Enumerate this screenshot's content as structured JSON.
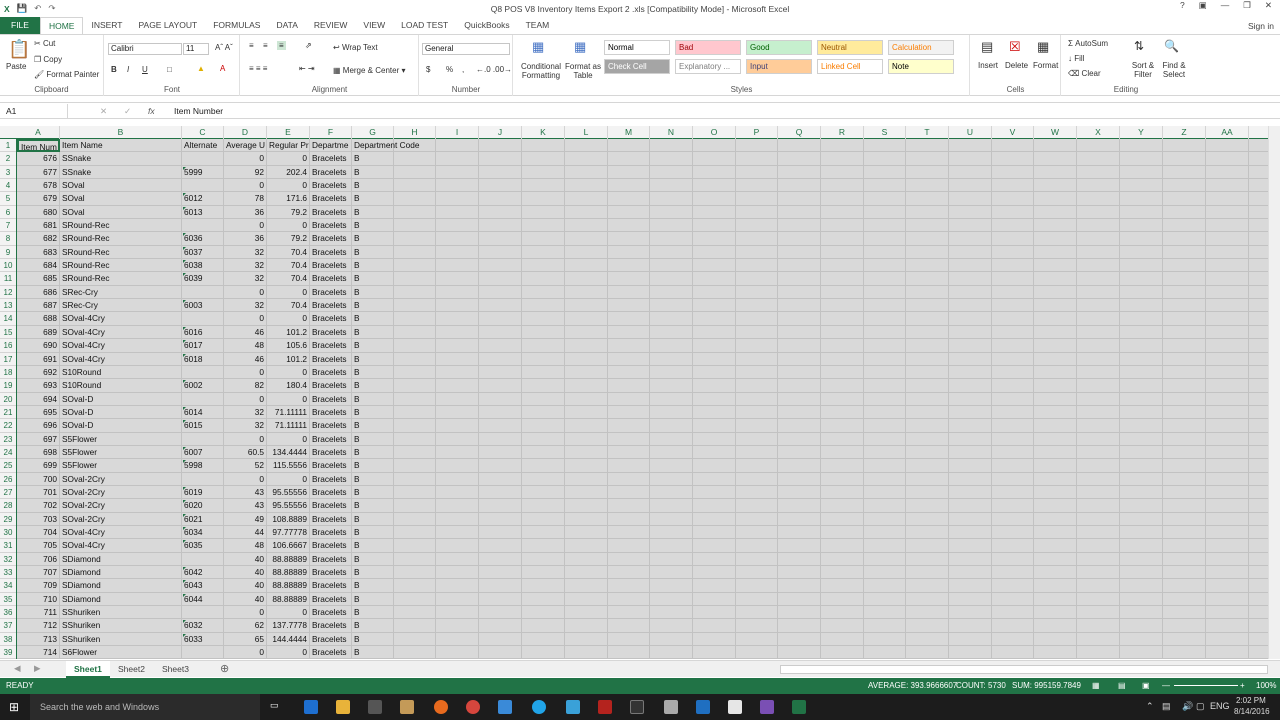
{
  "window": {
    "title": "Q8 POS V8 Inventory Items Export 2 .xls  [Compatibility Mode] - Microsoft Excel",
    "help": "?",
    "signin": "Sign in"
  },
  "tabs": [
    "FILE",
    "HOME",
    "INSERT",
    "PAGE LAYOUT",
    "FORMULAS",
    "DATA",
    "REVIEW",
    "VIEW",
    "LOAD TEST",
    "QuickBooks",
    "TEAM"
  ],
  "ribbon": {
    "clipboard": {
      "label": "Clipboard",
      "paste": "Paste",
      "cut": "Cut",
      "copy": "Copy",
      "format_painter": "Format Painter"
    },
    "font": {
      "label": "Font",
      "name": "Calibri",
      "size": "11",
      "bold": "B",
      "italic": "I",
      "underline": "U"
    },
    "alignment": {
      "label": "Alignment",
      "wrap": "Wrap Text",
      "merge": "Merge & Center"
    },
    "number": {
      "label": "Number",
      "format": "General",
      "currency": "$",
      "percent": "%",
      "comma": ","
    },
    "styles": {
      "label": "Styles",
      "conditional": "Conditional Formatting",
      "format_table": "Format as Table",
      "boxes": [
        {
          "t": "Normal",
          "bg": "#ffffff",
          "fg": "#000000"
        },
        {
          "t": "Bad",
          "bg": "#ffc7ce",
          "fg": "#9c0006"
        },
        {
          "t": "Good",
          "bg": "#c6efce",
          "fg": "#006100"
        },
        {
          "t": "Neutral",
          "bg": "#ffeb9c",
          "fg": "#9c5700"
        },
        {
          "t": "Calculation",
          "bg": "#f2f2f2",
          "fg": "#fa7d00"
        },
        {
          "t": "Check Cell",
          "bg": "#a5a5a5",
          "fg": "#ffffff"
        },
        {
          "t": "Explanatory ...",
          "bg": "#ffffff",
          "fg": "#7f7f7f"
        },
        {
          "t": "Input",
          "bg": "#ffcc99",
          "fg": "#3f3f76"
        },
        {
          "t": "Linked Cell",
          "bg": "#ffffff",
          "fg": "#fa7d00"
        },
        {
          "t": "Note",
          "bg": "#ffffcc",
          "fg": "#000000"
        }
      ]
    },
    "cells": {
      "label": "Cells",
      "insert": "Insert",
      "delete": "Delete",
      "format": "Format"
    },
    "editing": {
      "label": "Editing",
      "autosum": "AutoSum",
      "fill": "Fill",
      "clear": "Clear",
      "sort": "Sort & Filter",
      "find": "Find & Select"
    }
  },
  "formula_bar": {
    "name_box": "A1",
    "fx": "fx",
    "content": "Item Number"
  },
  "columns": [
    "A",
    "B",
    "C",
    "D",
    "E",
    "F",
    "G",
    "H",
    "I",
    "J",
    "K",
    "L",
    "M",
    "N",
    "O",
    "P",
    "Q",
    "R",
    "S",
    "T",
    "U",
    "V",
    "W",
    "X",
    "Y",
    "Z",
    "AA"
  ],
  "row_numbers": [
    "1",
    "2",
    "3",
    "4",
    "5",
    "6",
    "7",
    "8",
    "9",
    "10",
    "11",
    "12",
    "13",
    "14",
    "15",
    "16",
    "17",
    "18",
    "19",
    "20",
    "21",
    "22",
    "23",
    "24",
    "25",
    "26",
    "27",
    "28",
    "29",
    "30",
    "31",
    "32",
    "33",
    "34",
    "35",
    "36",
    "37",
    "38",
    "39"
  ],
  "headers": [
    "Item Num",
    "Item Name",
    "Alternate",
    "Average U",
    "Regular Pr",
    "Departme",
    "Department Code"
  ],
  "rows": [
    [
      "676",
      "SSnake",
      "",
      "0",
      "0",
      "Bracelets",
      "B"
    ],
    [
      "677",
      "SSnake",
      "5999",
      "92",
      "202.4",
      "Bracelets",
      "B"
    ],
    [
      "678",
      "SOval",
      "",
      "0",
      "0",
      "Bracelets",
      "B"
    ],
    [
      "679",
      "SOval",
      "6012",
      "78",
      "171.6",
      "Bracelets",
      "B"
    ],
    [
      "680",
      "SOval",
      "6013",
      "36",
      "79.2",
      "Bracelets",
      "B"
    ],
    [
      "681",
      "SRound-Rec",
      "",
      "0",
      "0",
      "Bracelets",
      "B"
    ],
    [
      "682",
      "SRound-Rec",
      "6036",
      "36",
      "79.2",
      "Bracelets",
      "B"
    ],
    [
      "683",
      "SRound-Rec",
      "6037",
      "32",
      "70.4",
      "Bracelets",
      "B"
    ],
    [
      "684",
      "SRound-Rec",
      "6038",
      "32",
      "70.4",
      "Bracelets",
      "B"
    ],
    [
      "685",
      "SRound-Rec",
      "6039",
      "32",
      "70.4",
      "Bracelets",
      "B"
    ],
    [
      "686",
      "SRec-Cry",
      "",
      "0",
      "0",
      "Bracelets",
      "B"
    ],
    [
      "687",
      "SRec-Cry",
      "6003",
      "32",
      "70.4",
      "Bracelets",
      "B"
    ],
    [
      "688",
      "SOval-4Cry",
      "",
      "0",
      "0",
      "Bracelets",
      "B"
    ],
    [
      "689",
      "SOval-4Cry",
      "6016",
      "46",
      "101.2",
      "Bracelets",
      "B"
    ],
    [
      "690",
      "SOval-4Cry",
      "6017",
      "48",
      "105.6",
      "Bracelets",
      "B"
    ],
    [
      "691",
      "SOval-4Cry",
      "6018",
      "46",
      "101.2",
      "Bracelets",
      "B"
    ],
    [
      "692",
      "S10Round",
      "",
      "0",
      "0",
      "Bracelets",
      "B"
    ],
    [
      "693",
      "S10Round",
      "6002",
      "82",
      "180.4",
      "Bracelets",
      "B"
    ],
    [
      "694",
      "SOval-D",
      "",
      "0",
      "0",
      "Bracelets",
      "B"
    ],
    [
      "695",
      "SOval-D",
      "6014",
      "32",
      "71.11111",
      "Bracelets",
      "B"
    ],
    [
      "696",
      "SOval-D",
      "6015",
      "32",
      "71.11111",
      "Bracelets",
      "B"
    ],
    [
      "697",
      "S5Flower",
      "",
      "0",
      "0",
      "Bracelets",
      "B"
    ],
    [
      "698",
      "S5Flower",
      "6007",
      "60.5",
      "134.4444",
      "Bracelets",
      "B"
    ],
    [
      "699",
      "S5Flower",
      "5998",
      "52",
      "115.5556",
      "Bracelets",
      "B"
    ],
    [
      "700",
      "SOval-2Cry",
      "",
      "0",
      "0",
      "Bracelets",
      "B"
    ],
    [
      "701",
      "SOval-2Cry",
      "6019",
      "43",
      "95.55556",
      "Bracelets",
      "B"
    ],
    [
      "702",
      "SOval-2Cry",
      "6020",
      "43",
      "95.55556",
      "Bracelets",
      "B"
    ],
    [
      "703",
      "SOval-2Cry",
      "6021",
      "49",
      "108.8889",
      "Bracelets",
      "B"
    ],
    [
      "704",
      "SOval-4Cry",
      "6034",
      "44",
      "97.77778",
      "Bracelets",
      "B"
    ],
    [
      "705",
      "SOval-4Cry",
      "6035",
      "48",
      "106.6667",
      "Bracelets",
      "B"
    ],
    [
      "706",
      "SDiamond",
      "",
      "40",
      "88.88889",
      "Bracelets",
      "B"
    ],
    [
      "707",
      "SDiamond",
      "6042",
      "40",
      "88.88889",
      "Bracelets",
      "B"
    ],
    [
      "709",
      "SDiamond",
      "6043",
      "40",
      "88.88889",
      "Bracelets",
      "B"
    ],
    [
      "710",
      "SDiamond",
      "6044",
      "40",
      "88.88889",
      "Bracelets",
      "B"
    ],
    [
      "711",
      "SShuriken",
      "",
      "0",
      "0",
      "Bracelets",
      "B"
    ],
    [
      "712",
      "SShuriken",
      "6032",
      "62",
      "137.7778",
      "Bracelets",
      "B"
    ],
    [
      "713",
      "SShuriken",
      "6033",
      "65",
      "144.4444",
      "Bracelets",
      "B"
    ],
    [
      "714",
      "S6Flower",
      "",
      "0",
      "0",
      "Bracelets",
      "B"
    ]
  ],
  "sheets": [
    "Sheet1",
    "Sheet2",
    "Sheet3"
  ],
  "status": {
    "ready": "READY",
    "average": "AVERAGE: 393.9666607",
    "count": "COUNT: 5730",
    "sum": "SUM: 995159.7849",
    "zoom": "100%"
  },
  "taskbar": {
    "search": "Search the web and Windows",
    "lang": "ENG",
    "time": "2:02 PM",
    "date": "8/14/2016"
  },
  "colors": {
    "accent": "#217346",
    "selection": "#d9d9d9"
  }
}
